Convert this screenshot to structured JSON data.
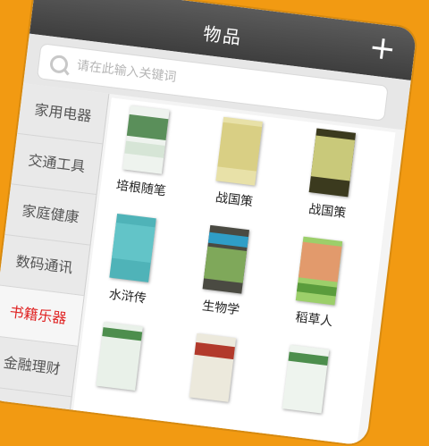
{
  "header": {
    "title": "物品",
    "add_label": "+"
  },
  "search": {
    "placeholder": "请在此输入关键词",
    "value": ""
  },
  "sidebar": {
    "items": [
      {
        "label": "家用电器",
        "active": false
      },
      {
        "label": "交通工具",
        "active": false
      },
      {
        "label": "家庭健康",
        "active": false
      },
      {
        "label": "数码通讯",
        "active": false
      },
      {
        "label": "书籍乐器",
        "active": true
      },
      {
        "label": "金融理财",
        "active": false
      }
    ]
  },
  "products": [
    {
      "title": "培根随笔"
    },
    {
      "title": "战国策"
    },
    {
      "title": "战国策"
    },
    {
      "title": "水浒传"
    },
    {
      "title": "生物学"
    },
    {
      "title": "稻草人"
    },
    {
      "title": ""
    },
    {
      "title": ""
    },
    {
      "title": ""
    }
  ],
  "colors": {
    "accent": "#e02424",
    "background": "#f29a12",
    "topbar": "#4a4a4a"
  }
}
